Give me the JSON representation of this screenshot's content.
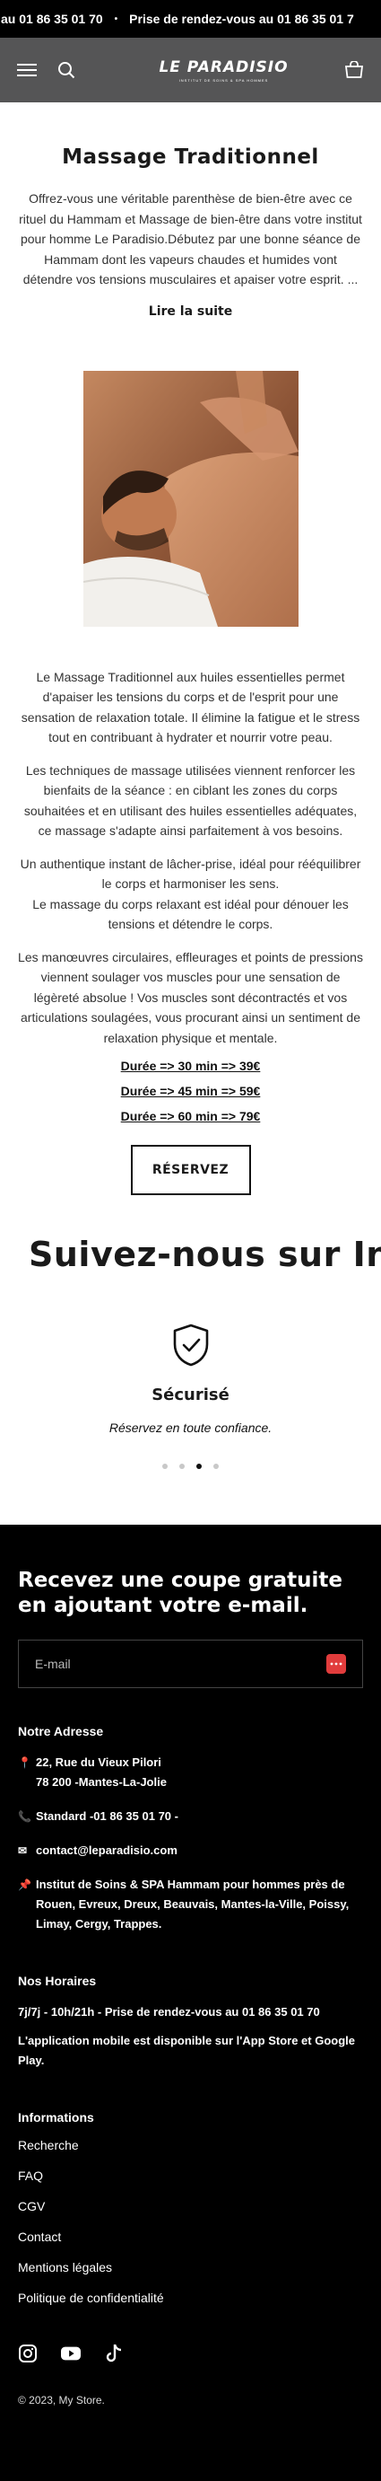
{
  "announcement": {
    "left": "au 01 86 35 01 70",
    "dot": "•",
    "right": "Prise de rendez-vous au 01 86 35 01 7"
  },
  "header": {
    "logo_text": "LE PARADISIO",
    "logo_tagline": "INSTITUT DE SOINS & SPA HOMMES"
  },
  "main": {
    "title": "Massage Traditionnel",
    "intro": "Offrez-vous une véritable parenthèse de bien-être avec ce rituel du Hammam et Massage de bien-être dans votre institut pour homme Le Paradisio.Débutez par une bonne séance de Hammam dont les vapeurs chaudes et humides vont détendre vos tensions musculaires et apaiser votre esprit. ...",
    "read_more": "Lire la suite",
    "paragraphs": [
      "Le Massage Traditionnel aux huiles essentielles permet d'apaiser les tensions du corps et de l'esprit pour une sensation de relaxation totale. Il élimine la fatigue et le stress tout en contribuant à hydrater et nourrir votre peau.",
      "Les techniques de massage utilisées viennent renforcer les bienfaits de la séance : en ciblant les zones du corps souhaitées et en utilisant des huiles essentielles adéquates, ce massage s'adapte ainsi parfaitement à vos besoins.",
      "Un authentique instant de lâcher-prise, idéal pour rééquilibrer le corps et harmoniser les sens.",
      "Le massage du corps relaxant est idéal pour dénouer les tensions et détendre le corps.",
      "Les manœuvres circulaires, effleurages et points de pressions viennent soulager vos muscles pour une sensation de légèreté absolue ! Vos muscles sont décontractés et vos articulations soulagées, vous procurant ainsi un sentiment de relaxation physique et mentale."
    ],
    "prices": [
      "Durée => 30 min => 39€",
      "Durée => 45 min => 59€",
      "Durée => 60 min => 79€"
    ],
    "reserve_label": "RÉSERVEZ",
    "follow_text": "Suivez-nous sur Ins",
    "feature": {
      "title": "Sécurisé",
      "text": "Réservez en toute confiance."
    },
    "carousel_active_index": 2
  },
  "footer": {
    "newsletter_title": "Recevez une coupe gratuite en ajoutant votre e-mail.",
    "email_placeholder": "E-mail",
    "address_heading": "Notre Adresse",
    "address_line1": "22, Rue du Vieux Pilori",
    "address_line2": "78 200 -Mantes-La-Jolie",
    "phone": "Standard -01 86 35 01 70 -",
    "email": "contact@leparadisio.com",
    "institute": "Institut de Soins & SPA Hammam pour hommes près de Rouen, Evreux, Dreux, Beauvais, Mantes-la-Ville, Poissy, Limay, Cergy, Trappes.",
    "hours_heading": "Nos Horaires",
    "hours_line": "7j/7j - 10h/21h - Prise de rendez-vous au 01 86 35 01 70",
    "app_line": "L'application mobile est disponible sur l'App Store et Google Play.",
    "info_heading": "Informations",
    "links": [
      "Recherche",
      "FAQ",
      "CGV",
      "Contact",
      "Mentions légales",
      "Politique de confidentialité"
    ],
    "copyright": "© 2023, My Store."
  },
  "icons": {
    "menu": "menu-icon",
    "search": "search-icon",
    "cart": "cart-icon",
    "shield": "shield-check-icon",
    "submit": "email-submit-icon",
    "pin": "pin-icon",
    "phone": "phone-icon",
    "mail": "mail-icon",
    "pushpin": "pushpin-icon",
    "instagram": "instagram-icon",
    "youtube": "youtube-icon",
    "tiktok": "tiktok-icon"
  },
  "colors": {
    "header_bg": "#555556",
    "footer_bg": "#000000",
    "submit_accent": "#e13c3c"
  }
}
